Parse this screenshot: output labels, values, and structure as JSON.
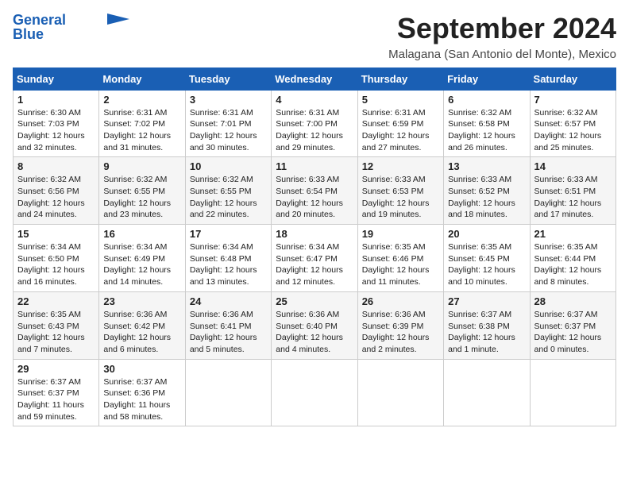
{
  "logo": {
    "line1": "General",
    "line2": "Blue"
  },
  "header": {
    "month": "September 2024",
    "location": "Malagana (San Antonio del Monte), Mexico"
  },
  "weekdays": [
    "Sunday",
    "Monday",
    "Tuesday",
    "Wednesday",
    "Thursday",
    "Friday",
    "Saturday"
  ],
  "weeks": [
    [
      {
        "day": "1",
        "sunrise": "6:30 AM",
        "sunset": "7:03 PM",
        "daylight": "12 hours and 32 minutes."
      },
      {
        "day": "2",
        "sunrise": "6:31 AM",
        "sunset": "7:02 PM",
        "daylight": "12 hours and 31 minutes."
      },
      {
        "day": "3",
        "sunrise": "6:31 AM",
        "sunset": "7:01 PM",
        "daylight": "12 hours and 30 minutes."
      },
      {
        "day": "4",
        "sunrise": "6:31 AM",
        "sunset": "7:00 PM",
        "daylight": "12 hours and 29 minutes."
      },
      {
        "day": "5",
        "sunrise": "6:31 AM",
        "sunset": "6:59 PM",
        "daylight": "12 hours and 27 minutes."
      },
      {
        "day": "6",
        "sunrise": "6:32 AM",
        "sunset": "6:58 PM",
        "daylight": "12 hours and 26 minutes."
      },
      {
        "day": "7",
        "sunrise": "6:32 AM",
        "sunset": "6:57 PM",
        "daylight": "12 hours and 25 minutes."
      }
    ],
    [
      {
        "day": "8",
        "sunrise": "6:32 AM",
        "sunset": "6:56 PM",
        "daylight": "12 hours and 24 minutes."
      },
      {
        "day": "9",
        "sunrise": "6:32 AM",
        "sunset": "6:55 PM",
        "daylight": "12 hours and 23 minutes."
      },
      {
        "day": "10",
        "sunrise": "6:32 AM",
        "sunset": "6:55 PM",
        "daylight": "12 hours and 22 minutes."
      },
      {
        "day": "11",
        "sunrise": "6:33 AM",
        "sunset": "6:54 PM",
        "daylight": "12 hours and 20 minutes."
      },
      {
        "day": "12",
        "sunrise": "6:33 AM",
        "sunset": "6:53 PM",
        "daylight": "12 hours and 19 minutes."
      },
      {
        "day": "13",
        "sunrise": "6:33 AM",
        "sunset": "6:52 PM",
        "daylight": "12 hours and 18 minutes."
      },
      {
        "day": "14",
        "sunrise": "6:33 AM",
        "sunset": "6:51 PM",
        "daylight": "12 hours and 17 minutes."
      }
    ],
    [
      {
        "day": "15",
        "sunrise": "6:34 AM",
        "sunset": "6:50 PM",
        "daylight": "12 hours and 16 minutes."
      },
      {
        "day": "16",
        "sunrise": "6:34 AM",
        "sunset": "6:49 PM",
        "daylight": "12 hours and 14 minutes."
      },
      {
        "day": "17",
        "sunrise": "6:34 AM",
        "sunset": "6:48 PM",
        "daylight": "12 hours and 13 minutes."
      },
      {
        "day": "18",
        "sunrise": "6:34 AM",
        "sunset": "6:47 PM",
        "daylight": "12 hours and 12 minutes."
      },
      {
        "day": "19",
        "sunrise": "6:35 AM",
        "sunset": "6:46 PM",
        "daylight": "12 hours and 11 minutes."
      },
      {
        "day": "20",
        "sunrise": "6:35 AM",
        "sunset": "6:45 PM",
        "daylight": "12 hours and 10 minutes."
      },
      {
        "day": "21",
        "sunrise": "6:35 AM",
        "sunset": "6:44 PM",
        "daylight": "12 hours and 8 minutes."
      }
    ],
    [
      {
        "day": "22",
        "sunrise": "6:35 AM",
        "sunset": "6:43 PM",
        "daylight": "12 hours and 7 minutes."
      },
      {
        "day": "23",
        "sunrise": "6:36 AM",
        "sunset": "6:42 PM",
        "daylight": "12 hours and 6 minutes."
      },
      {
        "day": "24",
        "sunrise": "6:36 AM",
        "sunset": "6:41 PM",
        "daylight": "12 hours and 5 minutes."
      },
      {
        "day": "25",
        "sunrise": "6:36 AM",
        "sunset": "6:40 PM",
        "daylight": "12 hours and 4 minutes."
      },
      {
        "day": "26",
        "sunrise": "6:36 AM",
        "sunset": "6:39 PM",
        "daylight": "12 hours and 2 minutes."
      },
      {
        "day": "27",
        "sunrise": "6:37 AM",
        "sunset": "6:38 PM",
        "daylight": "12 hours and 1 minute."
      },
      {
        "day": "28",
        "sunrise": "6:37 AM",
        "sunset": "6:37 PM",
        "daylight": "12 hours and 0 minutes."
      }
    ],
    [
      {
        "day": "29",
        "sunrise": "6:37 AM",
        "sunset": "6:37 PM",
        "daylight": "11 hours and 59 minutes."
      },
      {
        "day": "30",
        "sunrise": "6:37 AM",
        "sunset": "6:36 PM",
        "daylight": "11 hours and 58 minutes."
      },
      null,
      null,
      null,
      null,
      null
    ]
  ]
}
